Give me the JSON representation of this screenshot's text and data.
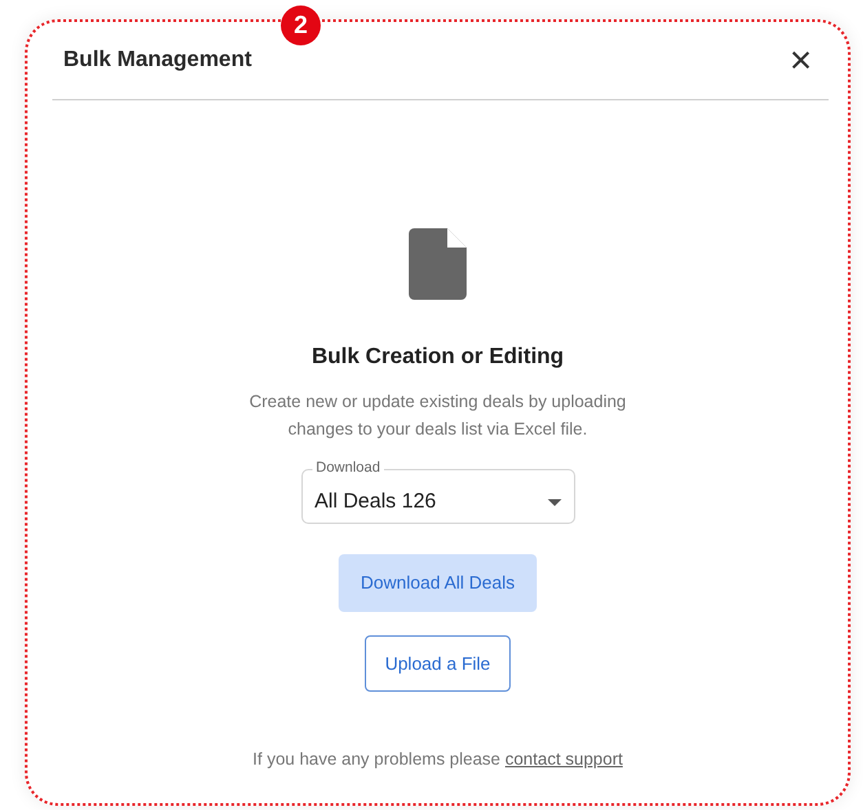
{
  "dialog": {
    "title": "Bulk Management",
    "close": "×",
    "step_badge": "2"
  },
  "section": {
    "heading": "Bulk Creation or Editing",
    "description": "Create new or update existing deals by uploading changes to your deals list via Excel file."
  },
  "download_select": {
    "label": "Download",
    "value": "All Deals 126"
  },
  "buttons": [
    {
      "label": "Download All Deals",
      "kind": "primary"
    },
    {
      "label": "Upload a File",
      "kind": "outline"
    }
  ],
  "footer": {
    "text": "If you have any problems please ",
    "link": "contact support"
  }
}
